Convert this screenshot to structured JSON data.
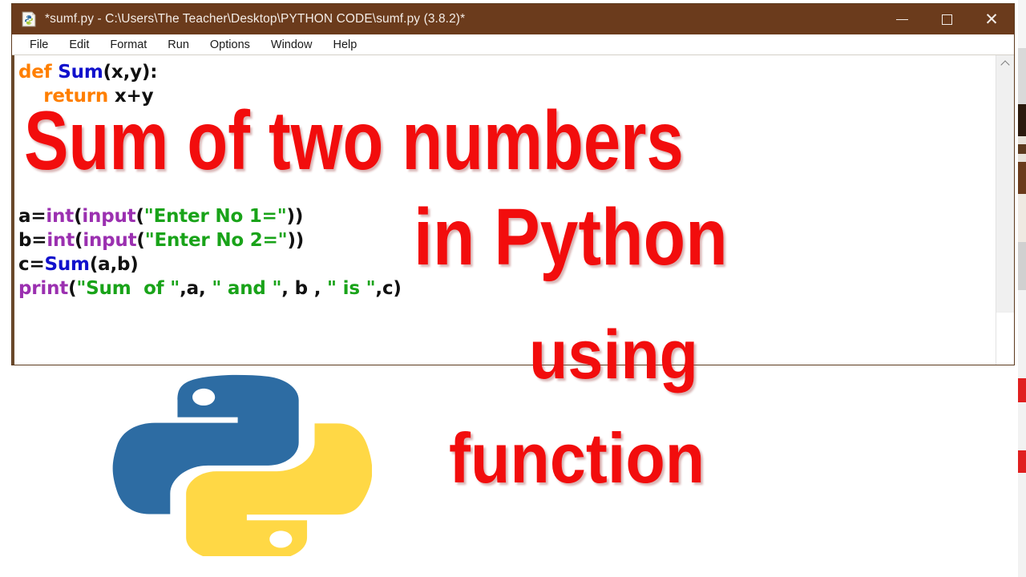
{
  "window": {
    "title": "*sumf.py - C:\\Users\\The Teacher\\Desktop\\PYTHON CODE\\sumf.py (3.8.2)*",
    "icon": "idle-python-file-icon",
    "controls": {
      "minimize": "minimize",
      "maximize": "maximize",
      "close": "close"
    },
    "titlebar_color": "#6b3b1c"
  },
  "menu": {
    "items": [
      {
        "label": "File"
      },
      {
        "label": "Edit"
      },
      {
        "label": "Format"
      },
      {
        "label": "Run"
      },
      {
        "label": "Options"
      },
      {
        "label": "Window"
      },
      {
        "label": "Help"
      }
    ]
  },
  "editor": {
    "code_lines": [
      "def Sum(x,y):",
      "    return x+y",
      "",
      "",
      "",
      "",
      "a=int(input(\"Enter No 1=\"))",
      "b=int(input(\"Enter No 2=\"))",
      "c=Sum(a,b)",
      "print(\"Sum  of \",a, \" and \", b , \" is \",c)"
    ],
    "syntax_colors": {
      "keyword": "#ff7f00",
      "function_name": "#1111cc",
      "builtin": "#9b30b0",
      "string": "#19a319",
      "plain": "#111111"
    },
    "scrollbar": {
      "up_arrow": "chevron-up-icon"
    }
  },
  "overlay": {
    "color": "#f20d0d",
    "lines": [
      {
        "text": "Sum of two numbers"
      },
      {
        "text": "in Python"
      },
      {
        "text": "using"
      },
      {
        "text": "function"
      }
    ]
  },
  "logo": {
    "name": "python-logo",
    "blue": "#2d6ca3",
    "yellow": "#ffd845"
  }
}
